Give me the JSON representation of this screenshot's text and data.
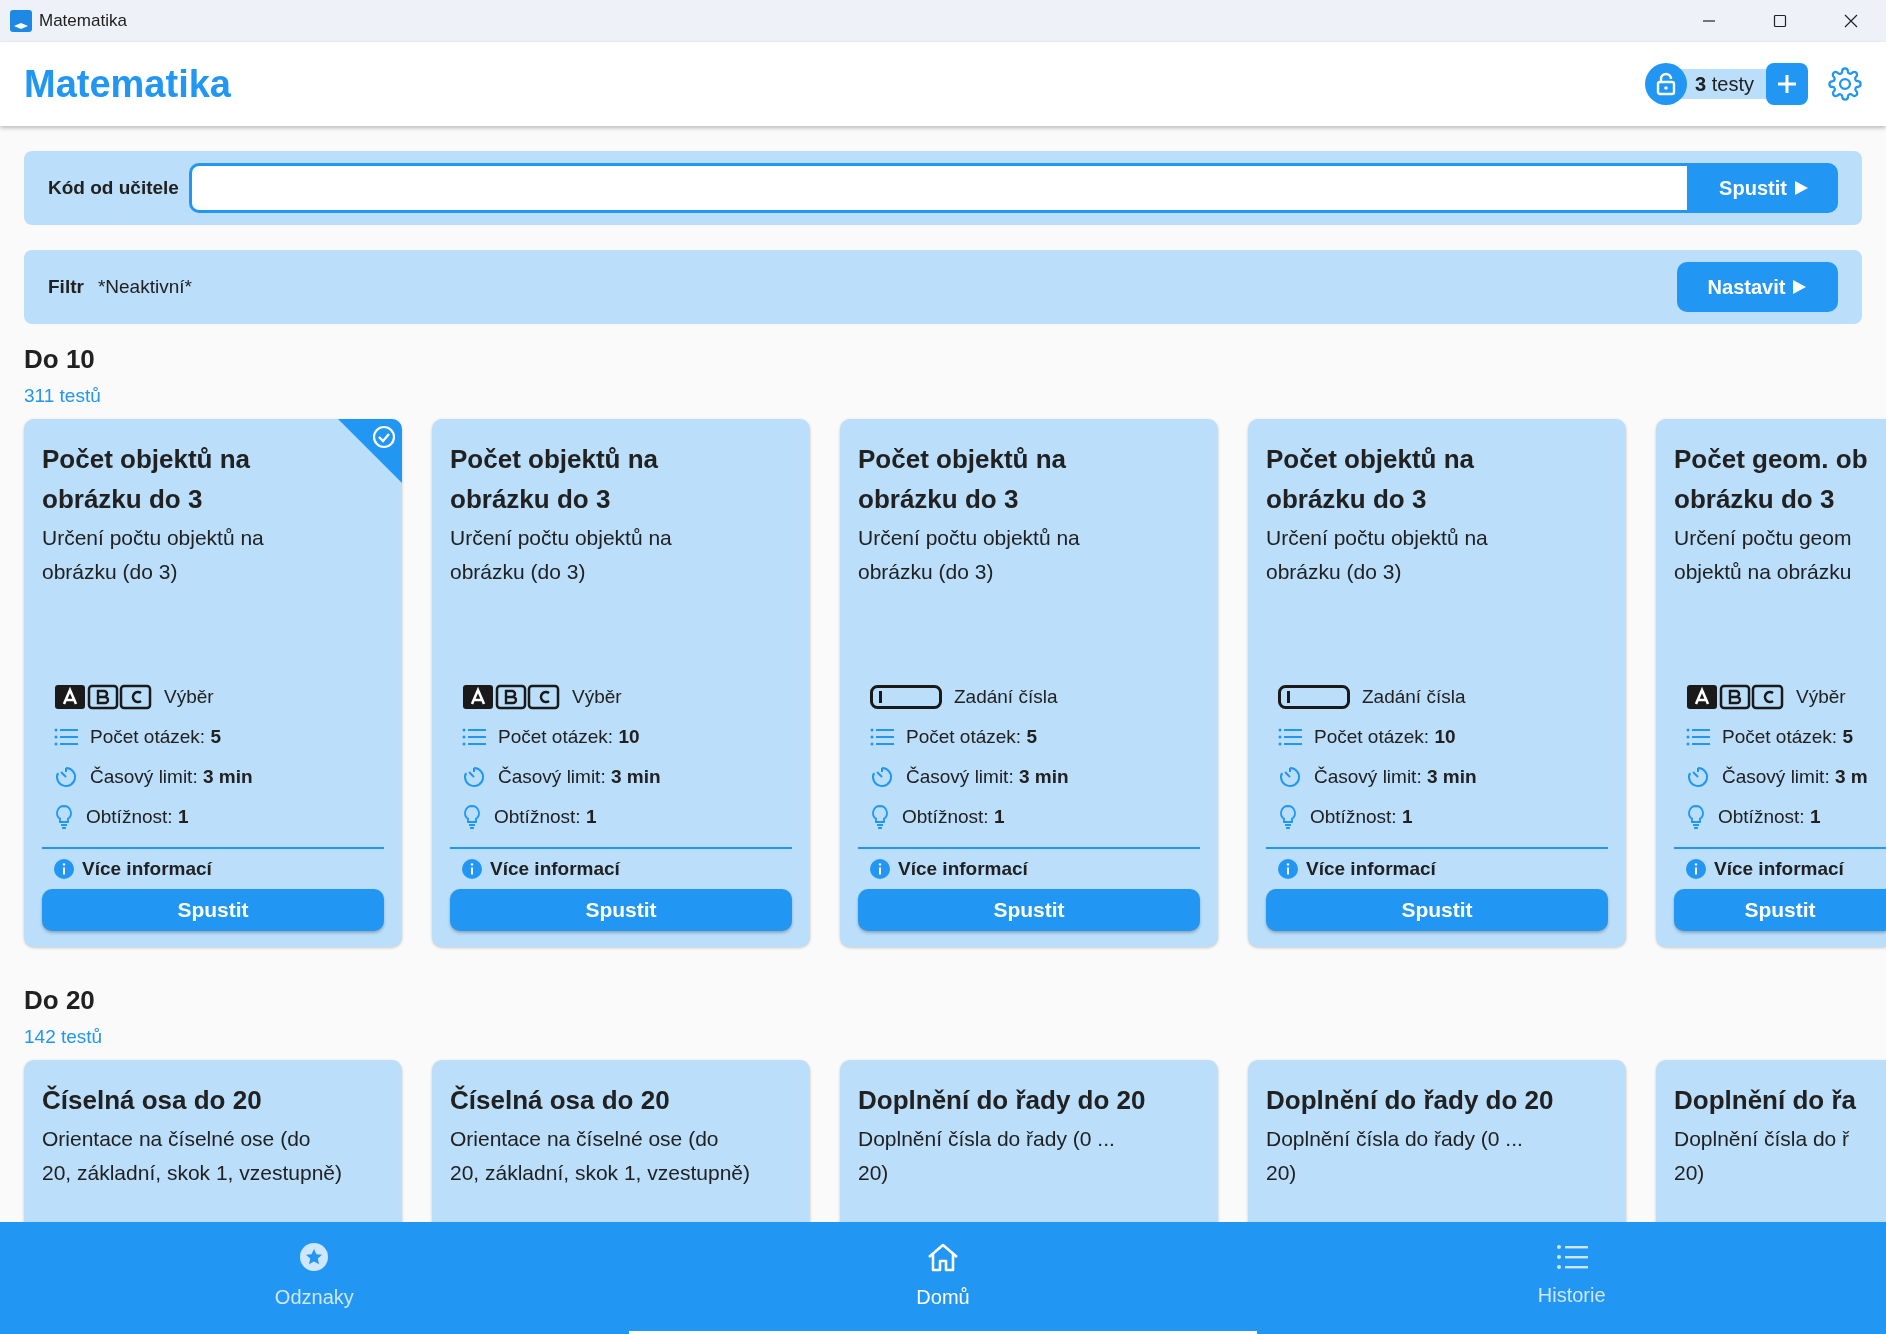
{
  "window": {
    "title": "Matematika"
  },
  "header": {
    "title": "Matematika",
    "tests": "**3** testy"
  },
  "code_bar": {
    "label": "Kód od učitele",
    "button": "Spustit"
  },
  "filter": {
    "label": "Filtr",
    "value": "*Neaktivní*",
    "button": "Nastavit"
  },
  "sections": [
    {
      "title": "Do 10",
      "count": "311 testů",
      "cards": [
        {
          "title": "Počet objektů na\nobrázku do 3",
          "description": "Určení počtu objektů na\nobrázku (do 3)",
          "completed": true,
          "kind": "choice",
          "answer_label": "Výběr",
          "questions": "Počet otázek: **5**",
          "time": "Časový limit: **3 min**",
          "difficulty": "Obtížnost: **1**",
          "more": "Více informací",
          "button": "Spustit"
        },
        {
          "title": "Počet objektů na\nobrázku do 3",
          "description": "Určení počtu objektů na\nobrázku (do 3)",
          "completed": false,
          "kind": "choice",
          "answer_label": "Výběr",
          "questions": "Počet otázek: **10**",
          "time": "Časový limit: **3 min**",
          "difficulty": "Obtížnost: **1**",
          "more": "Více informací",
          "button": "Spustit"
        },
        {
          "title": "Počet objektů na\nobrázku do 3",
          "description": "Určení počtu objektů na\nobrázku (do 3)",
          "completed": false,
          "kind": "number",
          "answer_label": "Zadání čísla",
          "questions": "Počet otázek: **5**",
          "time": "Časový limit: **3 min**",
          "difficulty": "Obtížnost: **1**",
          "more": "Více informací",
          "button": "Spustit"
        },
        {
          "title": "Počet objektů na\nobrázku do 3",
          "description": "Určení počtu objektů na\nobrázku (do 3)",
          "completed": false,
          "kind": "number",
          "answer_label": "Zadání čísla",
          "questions": "Počet otázek: **10**",
          "time": "Časový limit: **3 min**",
          "difficulty": "Obtížnost: **1**",
          "more": "Více informací",
          "button": "Spustit"
        },
        {
          "title": "Počet geom. ob\nobrázku do 3",
          "description": "Určení počtu geom\nobjektů na obrázku",
          "completed": false,
          "kind": "choice",
          "answer_label": "Výběr",
          "questions": "Počet otázek: **5**",
          "time": "Časový limit: **3 m**",
          "difficulty": "Obtížnost: **1**",
          "more": "Více informací",
          "button": "Spustit"
        }
      ]
    },
    {
      "title": "Do 20",
      "count": "142 testů",
      "cards": [
        {
          "title": "Číselná osa do 20",
          "description": "Orientace na číselné ose (do\n20, základní, skok 1, vzestupně)"
        },
        {
          "title": "Číselná osa do 20",
          "description": "Orientace na číselné ose (do\n20, základní, skok 1, vzestupně)"
        },
        {
          "title": "Doplnění do řady do 20",
          "description": "Doplnění čísla do řady (0 ...\n20)"
        },
        {
          "title": "Doplnění do řady do 20",
          "description": "Doplnění čísla do řady (0 ...\n20)"
        },
        {
          "title": "Doplnění do řa",
          "description": "Doplnění čísla do ř\n20)"
        }
      ]
    }
  ],
  "nav": [
    {
      "kind": "badges",
      "label": "Odznaky",
      "selected": false
    },
    {
      "kind": "home",
      "label": "Domů",
      "selected": true
    },
    {
      "kind": "history",
      "label": "Historie",
      "selected": false
    }
  ]
}
